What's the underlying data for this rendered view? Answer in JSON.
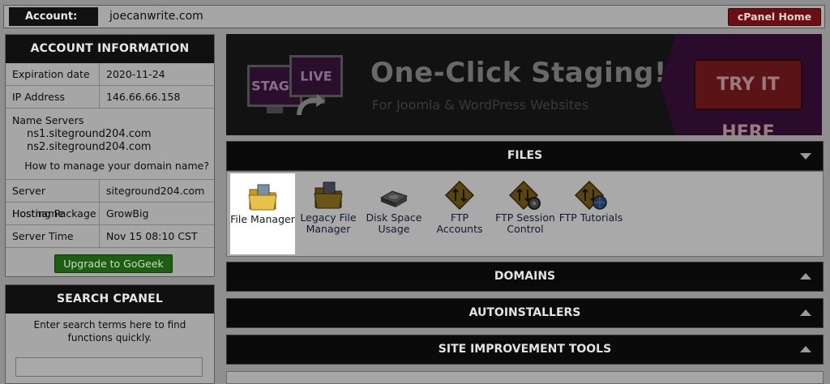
{
  "topbar": {
    "account_label": "Account:",
    "account_value": "joecanwrite.com",
    "home_button": "cPanel Home"
  },
  "account_info": {
    "title": "ACCOUNT INFORMATION",
    "rows_top": [
      {
        "key": "Expiration date",
        "value": "2020-11-24"
      },
      {
        "key": "IP Address",
        "value": "146.66.66.158"
      }
    ],
    "name_servers_title": "Name Servers",
    "ns1": "ns1.siteground204.com",
    "ns2": "ns2.siteground204.com",
    "ns_link": "How to manage your domain name?",
    "rows_bottom": [
      {
        "key": "Server Hostname",
        "value": "siteground204.com"
      },
      {
        "key": "Hosting Package",
        "value": "GrowBig"
      },
      {
        "key": "Server Time",
        "value": "Nov 15 08:10 CST"
      }
    ],
    "upgrade_button": "Upgrade to GoGeek"
  },
  "search": {
    "title": "SEARCH CPANEL",
    "hint": "Enter search terms here to find functions quickly.",
    "placeholder": ""
  },
  "banner": {
    "title": "One-Click Staging!",
    "subtitle": "For Joomla & WordPress Websites",
    "stage_label": "STAGE",
    "live_label": "LIVE",
    "cta": "TRY IT HERE"
  },
  "sections": {
    "files": "FILES",
    "domains": "DOMAINS",
    "autoinstallers": "AUTOINSTALLERS",
    "site_improvement": "SITE IMPROVEMENT TOOLS"
  },
  "files_items": [
    {
      "label": "File Manager",
      "icon": "folder-file-manager-icon"
    },
    {
      "label": "Legacy File Manager",
      "icon": "folder-legacy-icon"
    },
    {
      "label": "Disk Space Usage",
      "icon": "disk-icon"
    },
    {
      "label": "FTP Accounts",
      "icon": "ftp-accounts-icon"
    },
    {
      "label": "FTP Session Control",
      "icon": "ftp-session-icon"
    },
    {
      "label": "FTP Tutorials",
      "icon": "ftp-tutorials-icon"
    }
  ],
  "colors": {
    "overlay_bg": "#8f8f8f",
    "header_black": "#0a0a0a",
    "cpanel_home_red": "#6b0e12",
    "upgrade_green": "#1e5e12",
    "banner_purple": "#2a0b2c"
  }
}
